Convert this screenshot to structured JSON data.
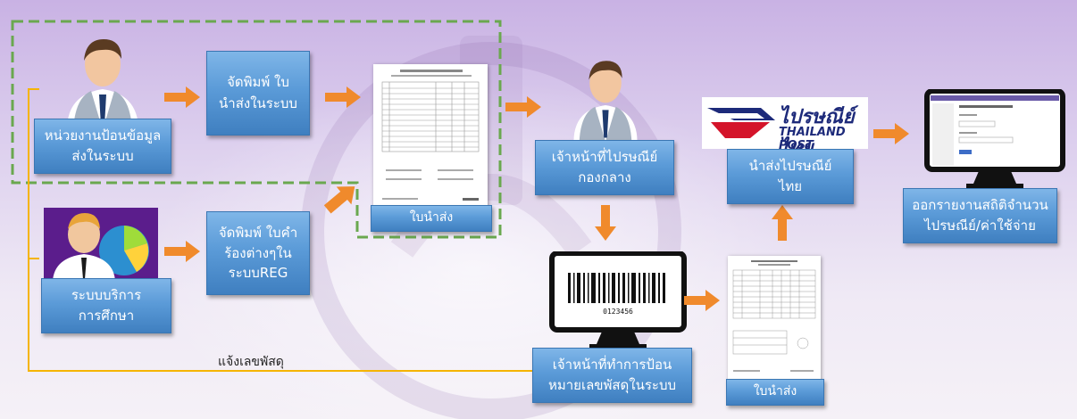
{
  "nodes": {
    "input_unit": [
      "หน่วยงานป้อนข้อมูล",
      "ส่งในระบบ"
    ],
    "print_slip": [
      "จัดพิมพ์ ใบ",
      "นำส่งในระบบ"
    ],
    "slip_top": "ใบนำส่ง",
    "reg_service": [
      "ระบบบริการ",
      "การศึกษา"
    ],
    "print_request": [
      "จัดพิมพ์ ใบคำ",
      "ร้องต่างๆใน",
      "ระบบREG"
    ],
    "central_officer": [
      "เจ้าหน้าที่ไปรษณีย์",
      "กองกลาง"
    ],
    "barcode_officer": [
      "เจ้าหน้าที่ทำการป้อน",
      "หมายเลขพัสดุในระบบ"
    ],
    "slip_bottom": "ใบนำส่ง",
    "send_post": [
      "นำส่งไปรษณีย์",
      "ไทย"
    ],
    "report": [
      "ออกรายงานสถิติจำนวน",
      "ไปรษณีย์/ค่าใช้จ่าย"
    ]
  },
  "feedback_label": "แจ้งเลขพัสดุ",
  "logo": {
    "thai": "ไปรษณีย์ไทย",
    "english": "THAILAND POST"
  },
  "barcode_number": "0123456",
  "colors": {
    "arrow": "#f08a2c",
    "box": "#5b9bd8",
    "feedback_line": "#f5b400",
    "dashed_border": "#6aa84f"
  }
}
